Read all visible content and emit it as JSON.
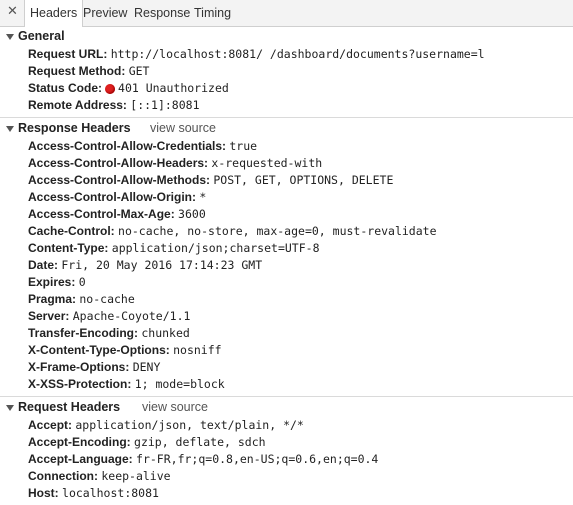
{
  "tabs": [
    "Headers",
    "Preview",
    "Response",
    "Timing"
  ],
  "general": {
    "title": "General",
    "rows": [
      {
        "key": "Request URL:",
        "value": "http://localhost:8081/    /dashboard/documents?username=l"
      },
      {
        "key": "Request Method:",
        "value": "GET"
      },
      {
        "key": "Status Code:",
        "value": "401 Unauthorized"
      },
      {
        "key": "Remote Address:",
        "value": "[::1]:8081"
      }
    ]
  },
  "response_headers": {
    "title": "Response Headers",
    "view_source": "view source",
    "rows": [
      {
        "key": "Access-Control-Allow-Credentials:",
        "value": "true"
      },
      {
        "key": "Access-Control-Allow-Headers:",
        "value": "x-requested-with"
      },
      {
        "key": "Access-Control-Allow-Methods:",
        "value": "POST, GET, OPTIONS, DELETE"
      },
      {
        "key": "Access-Control-Allow-Origin:",
        "value": "*"
      },
      {
        "key": "Access-Control-Max-Age:",
        "value": "3600"
      },
      {
        "key": "Cache-Control:",
        "value": "no-cache, no-store, max-age=0, must-revalidate"
      },
      {
        "key": "Content-Type:",
        "value": "application/json;charset=UTF-8"
      },
      {
        "key": "Date:",
        "value": "Fri, 20 May 2016 17:14:23 GMT"
      },
      {
        "key": "Expires:",
        "value": "0"
      },
      {
        "key": "Pragma:",
        "value": "no-cache"
      },
      {
        "key": "Server:",
        "value": "Apache-Coyote/1.1"
      },
      {
        "key": "Transfer-Encoding:",
        "value": "chunked"
      },
      {
        "key": "X-Content-Type-Options:",
        "value": "nosniff"
      },
      {
        "key": "X-Frame-Options:",
        "value": "DENY"
      },
      {
        "key": "X-XSS-Protection:",
        "value": "1; mode=block"
      }
    ]
  },
  "request_headers": {
    "title": "Request Headers",
    "view_source": "view source",
    "rows": [
      {
        "key": "Accept:",
        "value": "application/json, text/plain, */*"
      },
      {
        "key": "Accept-Encoding:",
        "value": "gzip, deflate, sdch"
      },
      {
        "key": "Accept-Language:",
        "value": "fr-FR,fr;q=0.8,en-US;q=0.6,en;q=0.4"
      },
      {
        "key": "Connection:",
        "value": "keep-alive"
      },
      {
        "key": "Host:",
        "value": "localhost:8081"
      }
    ]
  },
  "colors": {
    "status_error": "#e02020"
  },
  "icons": {
    "close": "close-icon",
    "expand": "triangle-down-icon",
    "status": "status-dot-icon"
  }
}
